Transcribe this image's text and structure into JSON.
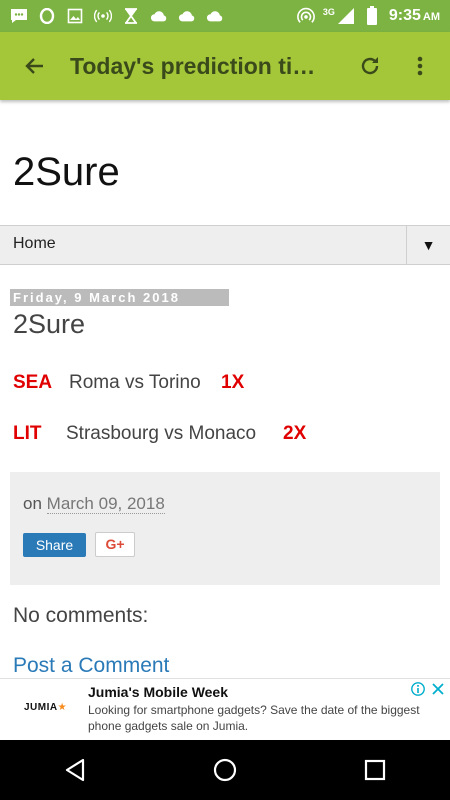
{
  "status_bar": {
    "time": "9:35",
    "ampm": "AM",
    "network": "3G",
    "icons": [
      "message-icon",
      "opera-icon",
      "image-icon",
      "radio-icon",
      "hourglass-icon",
      "cloud-icon",
      "cloud-icon",
      "cloud-icon",
      "hotspot-icon",
      "signal-icon",
      "battery-icon"
    ]
  },
  "toolbar": {
    "title": "Today's prediction tips",
    "icons": [
      "back-arrow-icon",
      "refresh-icon",
      "more-vert-icon"
    ]
  },
  "blog": {
    "title": "2Sure",
    "nav_home": "Home",
    "nav_dropdown": "▼"
  },
  "post": {
    "date_header": "Friday, 9 March 2018",
    "title": "2Sure",
    "predictions": [
      {
        "code": "SEA",
        "match": "Roma vs Torino",
        "tip": "1X"
      },
      {
        "code": "LIT",
        "match": "Strasbourg vs Monaco",
        "tip": "2X"
      }
    ],
    "posted_on_label": "on",
    "posted_date": "March 09, 2018",
    "share_label": "Share",
    "gplus_label": "G+",
    "comments_heading": "No comments:",
    "post_comment_label": "Post a Comment"
  },
  "ad": {
    "logo": "JUMIA",
    "title": "Jumia's Mobile Week",
    "text": "Looking for smartphone gadgets? Save the date of the biggest phone gadgets sale on Jumia.",
    "icons": [
      "info-icon",
      "close-icon"
    ]
  },
  "colors": {
    "status_bar": "#7cb342",
    "toolbar": "#a4c639",
    "prediction_red": "#e00000",
    "link_blue": "#2a7ab8"
  }
}
